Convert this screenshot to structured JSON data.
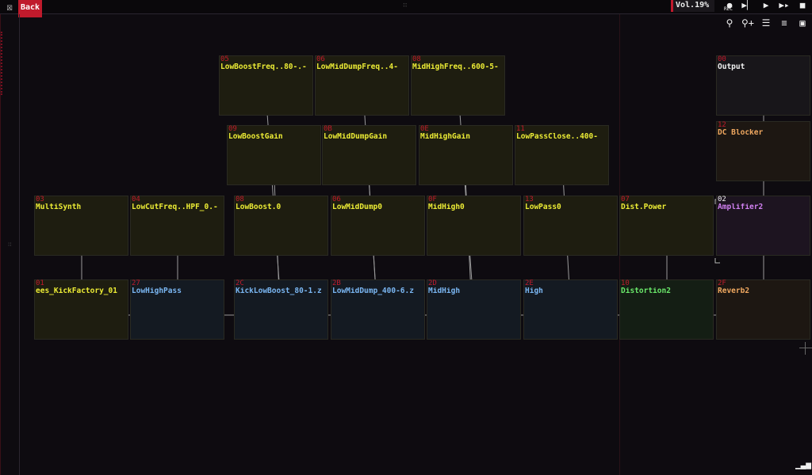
{
  "header": {
    "back_label": "Back",
    "volume": "Vol.19%",
    "rec_label": "REC"
  },
  "modules": [
    {
      "num": "05",
      "name": "LowBoostFreq..80-.-",
      "color": "yel"
    },
    {
      "num": "06",
      "name": "LowMidDumpFreq..4-",
      "color": "yel"
    },
    {
      "num": "08",
      "name": "MidHighFreq..600-5-",
      "color": "yel"
    },
    {
      "num": "00",
      "name": "Output",
      "color": "wht"
    },
    {
      "num": "09",
      "name": "LowBoostGain",
      "color": "yel"
    },
    {
      "num": "0B",
      "name": "LowMidDumpGain",
      "color": "yel"
    },
    {
      "num": "0E",
      "name": "MidHighGain",
      "color": "yel"
    },
    {
      "num": "11",
      "name": "LowPassClose..400-",
      "color": "yel"
    },
    {
      "num": "12",
      "name": "DC Blocker",
      "color": "org"
    },
    {
      "num": "03",
      "name": "MultiSynth",
      "color": "yel"
    },
    {
      "num": "04",
      "name": "LowCutFreq..HPF_0.-",
      "color": "yel"
    },
    {
      "num": "08",
      "name": "LowBoost.0",
      "color": "yel"
    },
    {
      "num": "06",
      "name": "LowMidDump0",
      "color": "yel"
    },
    {
      "num": "0F",
      "name": "MidHigh0",
      "color": "yel"
    },
    {
      "num": "13",
      "name": "LowPass0",
      "color": "yel"
    },
    {
      "num": "07",
      "name": "Dist.Power",
      "color": "yel"
    },
    {
      "num": "02",
      "name": "Amplifier2",
      "color": "pur"
    },
    {
      "num": "01",
      "name": "ees_KickFactory_01",
      "color": "yel"
    },
    {
      "num": "27",
      "name": "LowHighPass",
      "color": "blu"
    },
    {
      "num": "2C",
      "name": "KickLowBoost_80-1.z",
      "color": "blu"
    },
    {
      "num": "2B",
      "name": "LowMidDump_400-6.z",
      "color": "blu"
    },
    {
      "num": "2D",
      "name": "MidHigh",
      "color": "blu"
    },
    {
      "num": "2E",
      "name": "High",
      "color": "blu"
    },
    {
      "num": "10",
      "name": "Distortion2",
      "color": "grn"
    },
    {
      "num": "2F",
      "name": "Reverb2",
      "color": "org"
    }
  ],
  "transport": [
    "rec-icon",
    "play-loop-icon",
    "play-icon",
    "play-pattern-icon",
    "stop-icon"
  ],
  "tools": [
    "add-module-icon",
    "add-link-icon",
    "menu-icon",
    "mixer-icon",
    "layout-icon"
  ]
}
